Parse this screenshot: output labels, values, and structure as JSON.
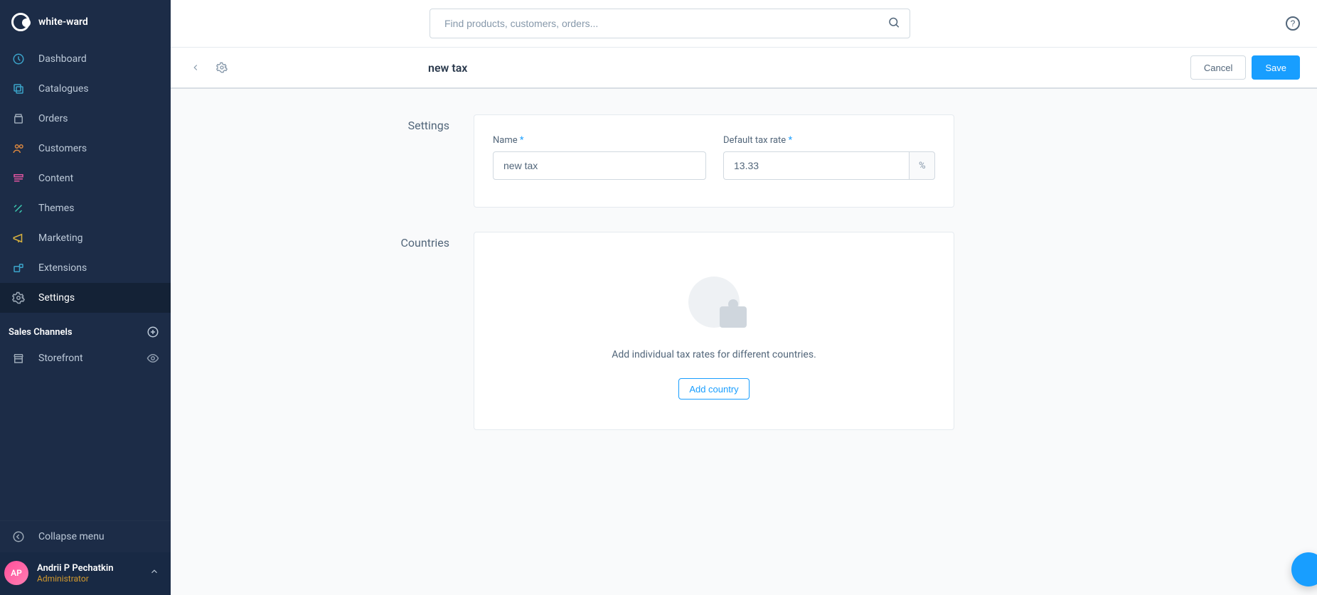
{
  "brand": "white-ward",
  "nav": [
    {
      "label": "Dashboard",
      "icon": "dashboard",
      "color": "#3ba3c9"
    },
    {
      "label": "Catalogues",
      "icon": "catalog",
      "color": "#3ba3c9"
    },
    {
      "label": "Orders",
      "icon": "orders",
      "color": "#9aa7b5"
    },
    {
      "label": "Customers",
      "icon": "customers",
      "color": "#d9863f"
    },
    {
      "label": "Content",
      "icon": "content",
      "color": "#e055a0"
    },
    {
      "label": "Themes",
      "icon": "themes",
      "color": "#3cc9b0"
    },
    {
      "label": "Marketing",
      "icon": "marketing",
      "color": "#d9b23f"
    },
    {
      "label": "Extensions",
      "icon": "extensions",
      "color": "#3ba3c9"
    },
    {
      "label": "Settings",
      "icon": "settings",
      "color": "#9aa7b5",
      "active": true
    }
  ],
  "sales_channels_title": "Sales Channels",
  "sales_channels": [
    {
      "label": "Storefront"
    }
  ],
  "collapse_label": "Collapse menu",
  "user": {
    "initials": "AP",
    "name": "Andrii P Pechatkin",
    "role": "Administrator"
  },
  "search": {
    "placeholder": "Find products, customers, orders..."
  },
  "page": {
    "title": "new tax",
    "cancel": "Cancel",
    "save": "Save"
  },
  "settings_section": {
    "heading": "Settings",
    "name_label": "Name",
    "name_value": "new tax",
    "rate_label": "Default tax rate",
    "rate_value": "13.33",
    "rate_unit": "%"
  },
  "countries_section": {
    "heading": "Countries",
    "empty_text": "Add individual tax rates for different countries.",
    "add_button": "Add country"
  }
}
